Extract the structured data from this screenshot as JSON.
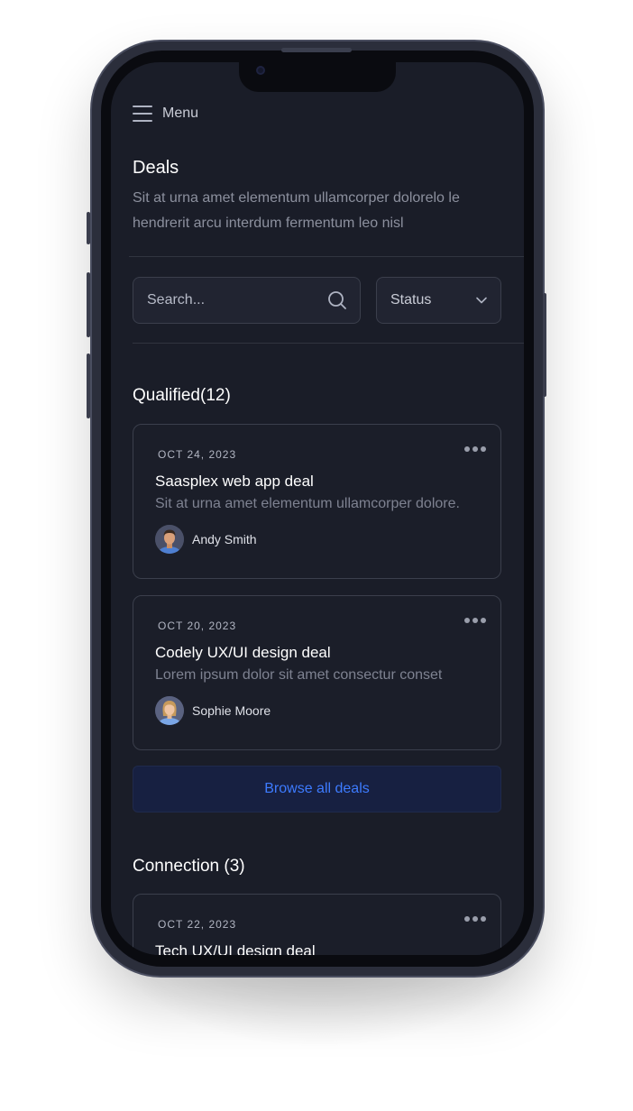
{
  "menu": {
    "label": "Menu",
    "icon": "hamburger-icon"
  },
  "header": {
    "title": "Deals",
    "description": "Sit at urna amet elementum ullamcorper dolorelo le hendrerit arcu interdum fermentum leo nisl"
  },
  "filters": {
    "search_placeholder": "Search...",
    "status_label": "Status"
  },
  "sections": [
    {
      "title": "Qualified(12)",
      "deals": [
        {
          "date": "OCT 24, 2023",
          "title": "Saasplex web app deal",
          "description": "Sit at urna amet elementum ullamcorper dolore.",
          "owner": "Andy Smith"
        },
        {
          "date": "OCT 20, 2023",
          "title": "Codely UX/UI design deal",
          "description": "Lorem ipsum dolor sit amet consectur conset",
          "owner": "Sophie Moore"
        }
      ],
      "browse_label": "Browse all deals"
    },
    {
      "title": "Connection (3)",
      "deals": [
        {
          "date": "OCT 22, 2023",
          "title": "Tech UX/UI design deal"
        }
      ]
    }
  ],
  "colors": {
    "background": "#1a1d28",
    "accent": "#3d7bff",
    "button_bg": "#172041"
  }
}
